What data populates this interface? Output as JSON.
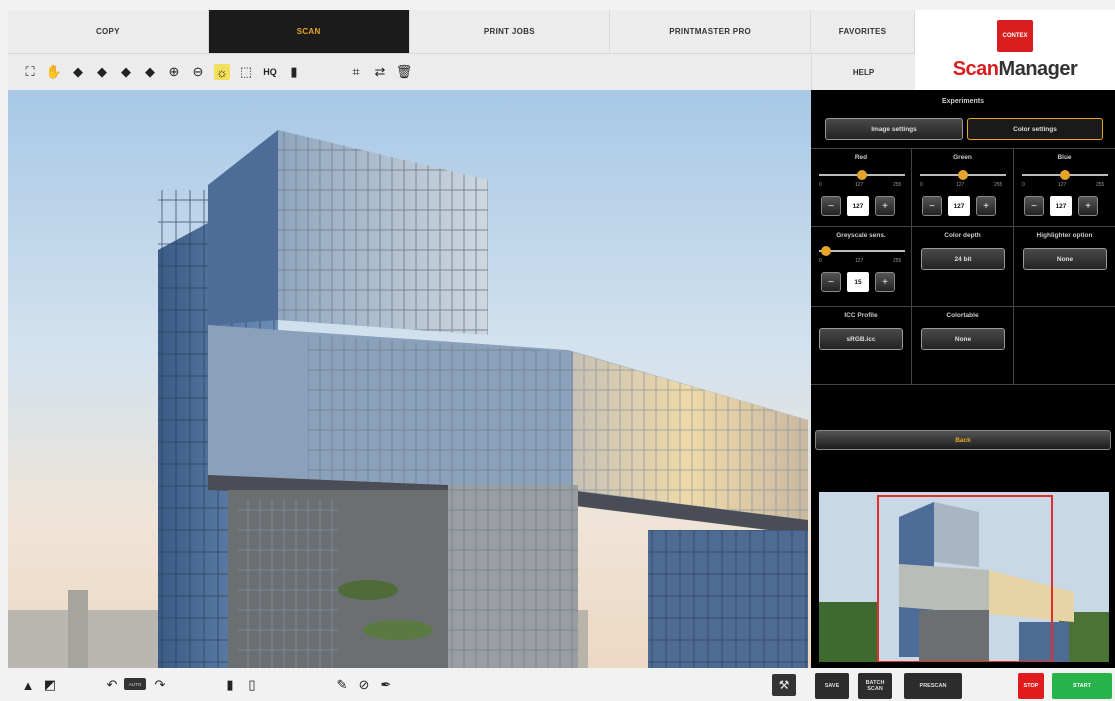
{
  "tabs": [
    {
      "label": "COPY"
    },
    {
      "label": "SCAN"
    },
    {
      "label": "PRINT JOBS"
    },
    {
      "label": "PRINTMASTER PRO"
    },
    {
      "label": "FAVORITES"
    }
  ],
  "help_tab": "HELP",
  "logo": {
    "badge": "CONTEX",
    "text_left": "Scan",
    "text_right": "Manager"
  },
  "panel": {
    "title": "Experiments",
    "image_settings_label": "Image settings",
    "color_settings_label": "Color settings",
    "channels": [
      {
        "label": "Red",
        "value": "127",
        "min": "0",
        "mid": "127",
        "max": "255"
      },
      {
        "label": "Green",
        "value": "127",
        "min": "0",
        "mid": "127",
        "max": "255"
      },
      {
        "label": "Blue",
        "value": "127",
        "min": "0",
        "mid": "127",
        "max": "255"
      }
    ],
    "greyscale": {
      "label": "Greyscale sens.",
      "value": "15",
      "min": "0",
      "mid": "127",
      "max": "255"
    },
    "color_depth": {
      "label": "Color depth",
      "value": "24 bit"
    },
    "highlighter": {
      "label": "Highlighter option",
      "value": "None"
    },
    "icc": {
      "label": "ICC Profile",
      "value": "sRGB.icc"
    },
    "colortable": {
      "label": "Colortable",
      "value": "None"
    },
    "back_label": "Back"
  },
  "actions": {
    "save": "SAVE",
    "batch_scan": "BATCH SCAN",
    "prescan": "PRESCAN",
    "stop": "STOP",
    "start": "START"
  },
  "chip_label": "AUTO",
  "toolbar_icons": [
    "select-all-icon",
    "hand-icon",
    "arrow-left-icon",
    "arrow-right-icon",
    "arrow-up-icon",
    "arrow-down-icon",
    "zoom-in-icon",
    "zoom-out-icon",
    "auto-adjust-icon",
    "crop-frame-icon",
    "hq-icon",
    "document-icon",
    "selection-box-icon",
    "flip-icon",
    "trash-icon"
  ],
  "hq_label": "HQ",
  "colors": {
    "accent": "#e7a52a",
    "stop": "#e11b1b",
    "start": "#27b24a",
    "panel_bg": "#000000"
  }
}
